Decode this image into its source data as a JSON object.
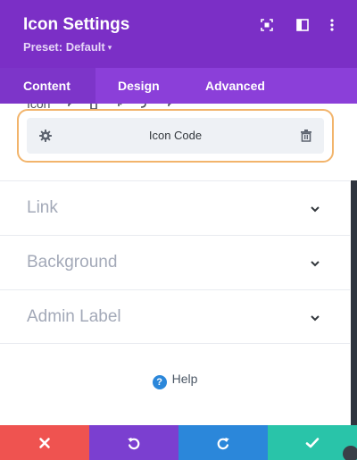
{
  "header": {
    "title": "Icon Settings",
    "preset": "Preset: Default",
    "preset_caret": "▾",
    "icons": [
      "fullscreen-icon",
      "split-view-icon",
      "more-menu-icon"
    ],
    "background_color": "#7b2fc6"
  },
  "tabs": [
    {
      "label": "Content",
      "active": true
    },
    {
      "label": "Design",
      "active": false
    },
    {
      "label": "Advanced",
      "active": false
    }
  ],
  "icon_row": {
    "label": "Icon"
  },
  "icon_code": {
    "label": "Icon Code",
    "left_icon": "gear-icon",
    "right_icon": "trash-icon",
    "highlight_color": "#f2b46b"
  },
  "sections": [
    {
      "label": "Link",
      "icon": "chevron-down-icon"
    },
    {
      "label": "Background",
      "icon": "chevron-down-icon"
    },
    {
      "label": "Admin Label",
      "icon": "chevron-down-icon"
    }
  ],
  "help": {
    "label": "Help",
    "icon_glyph": "?"
  },
  "footer": {
    "buttons": [
      {
        "name": "discard",
        "icon": "close-icon",
        "color": "#ef5350"
      },
      {
        "name": "undo",
        "icon": "undo-icon",
        "color": "#7b3fd0"
      },
      {
        "name": "redo",
        "icon": "redo-icon",
        "color": "#2b87da"
      },
      {
        "name": "save",
        "icon": "check-icon",
        "color": "#29c4a9"
      }
    ]
  }
}
